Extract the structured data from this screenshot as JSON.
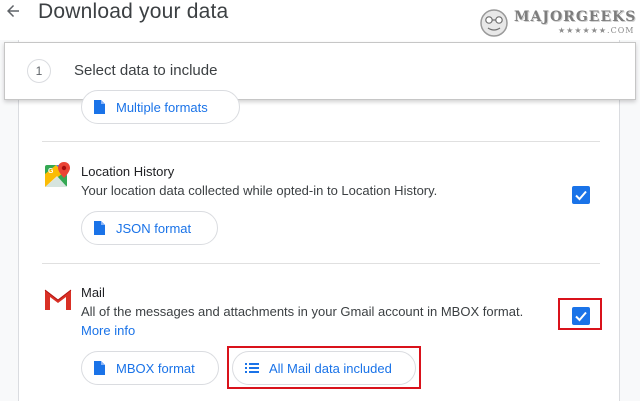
{
  "header": {
    "title": "Download your data",
    "back_icon": "arrow-back-icon"
  },
  "watermark": {
    "text": "MAJORGEEKS",
    "subtext": "★★★★★★.COM"
  },
  "step": {
    "number": "1",
    "label": "Select data to include"
  },
  "items": {
    "previous": {
      "format_chip": "Multiple formats"
    },
    "location_history": {
      "icon": "google-maps-icon",
      "title": "Location History",
      "description": "Your location data collected while opted-in to Location History.",
      "format_chip": "JSON format",
      "checked": true
    },
    "mail": {
      "icon": "gmail-icon",
      "title": "Mail",
      "description": "All of the messages and attachments in your Gmail account in MBOX format.",
      "more_info": "More info",
      "format_chip": "MBOX format",
      "data_chip": "All Mail data included",
      "checked": true
    }
  },
  "colors": {
    "accent": "#1a73e8",
    "highlight": "#d9121b",
    "divider": "#e0e0e0"
  }
}
